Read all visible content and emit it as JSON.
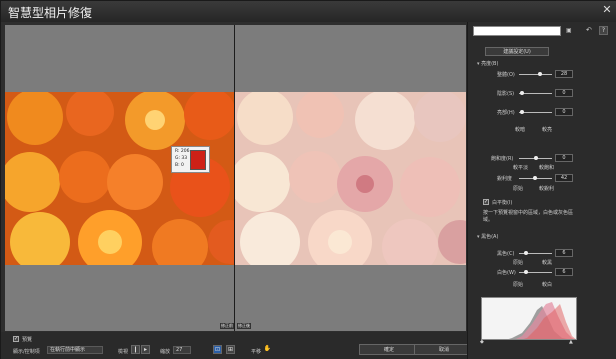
{
  "window": {
    "title": "智慧型相片修復",
    "close": "✕"
  },
  "pixel_info": {
    "r": "R: 206",
    "g": "G: 33",
    "b": "B: 0",
    "color": "#ce2117"
  },
  "canvas_labels": {
    "before": "修正前",
    "after": "修正後"
  },
  "bottom": {
    "preview_label": "預覽",
    "display_mode_label": "顯示/控制項",
    "display_mode_value": "在執行前中顯示",
    "zoom_label": "縮放",
    "zoom_value": "27",
    "pan_label": "平移",
    "compare_label": "檢視",
    "ok": "確定",
    "cancel": "取消"
  },
  "panel": {
    "suggest_button": "建議設定(U)",
    "brightness_section": "亮度(B)",
    "sliders_top": [
      {
        "label": "整體(O)",
        "value": "28"
      },
      {
        "label": "陰影(S)",
        "value": "0"
      },
      {
        "label": "亮部(H)",
        "value": "0"
      }
    ],
    "row_dark_bright": [
      "較暗",
      "較亮"
    ],
    "saturation": {
      "label": "飽和度(R)",
      "value": "0"
    },
    "row_sat": [
      "較平淡",
      "較飽和"
    ],
    "sharpness": {
      "label": "銳利度",
      "value": "42"
    },
    "row_sharp": [
      "原始",
      "較銳利"
    ],
    "white_balance": {
      "title": "白平衡(I)",
      "desc": "按一下預覽視窗中的區域，白色或灰色區域。"
    },
    "black_section": "黑色(A)",
    "black": {
      "label": "黑色(C)",
      "value": "6"
    },
    "row_black": [
      "原始",
      "較黑"
    ],
    "white": {
      "label": "白色(W)",
      "value": "6"
    },
    "row_white": [
      "原始",
      "較白"
    ]
  }
}
